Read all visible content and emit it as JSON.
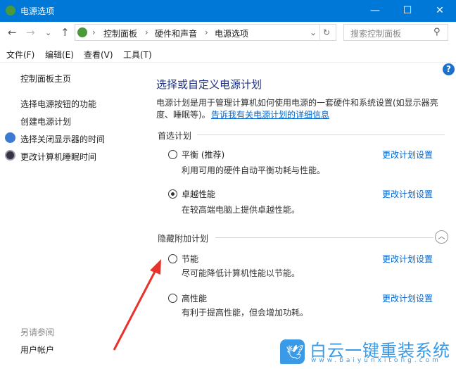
{
  "window": {
    "title": "电源选项",
    "minimize": "—",
    "maximize": "☐",
    "close": "✕"
  },
  "nav": {
    "back": "←",
    "forward": "→",
    "recent": "⌄",
    "up": "↑",
    "refresh": "↻",
    "dropdown": "⌄"
  },
  "breadcrumb": [
    "控制面板",
    "硬件和声音",
    "电源选项"
  ],
  "search": {
    "placeholder": "搜索控制面板"
  },
  "menu": [
    "文件(F)",
    "编辑(E)",
    "查看(V)",
    "工具(T)"
  ],
  "sidebar": {
    "items": [
      "控制面板主页",
      "选择电源按钮的功能",
      "创建电源计划",
      "选择关闭显示器的时间",
      "更改计算机睡眠时间"
    ],
    "see_also": "另请参阅",
    "see_also_items": [
      "用户帐户"
    ]
  },
  "main": {
    "title": "选择或自定义电源计划",
    "desc1": "电源计划是用于管理计算机如何使用电源的一套硬件和系统设置(如显示器亮",
    "desc2": "度、睡眠等)。",
    "desc_link": "告诉我有关电源计划的详细信息",
    "preferred_label": "首选计划",
    "hidden_label": "隐藏附加计划",
    "change_link": "更改计划设置",
    "plans": [
      {
        "name": "平衡 (推荐)",
        "desc": "利用可用的硬件自动平衡功耗与性能。",
        "selected": false
      },
      {
        "name": "卓越性能",
        "desc": "在较高端电脑上提供卓越性能。",
        "selected": true
      },
      {
        "name": "节能",
        "desc": "尽可能降低计算机性能以节能。",
        "selected": false
      },
      {
        "name": "高性能",
        "desc": "有利于提高性能，但会增加功耗。",
        "selected": false
      }
    ]
  },
  "watermark": {
    "text": "白云一键重装系统",
    "url": "www.baiyunxitong.com"
  },
  "colors": {
    "titlebar": "#0078d7",
    "link": "#0066cc",
    "arrow": "#e8322c"
  }
}
